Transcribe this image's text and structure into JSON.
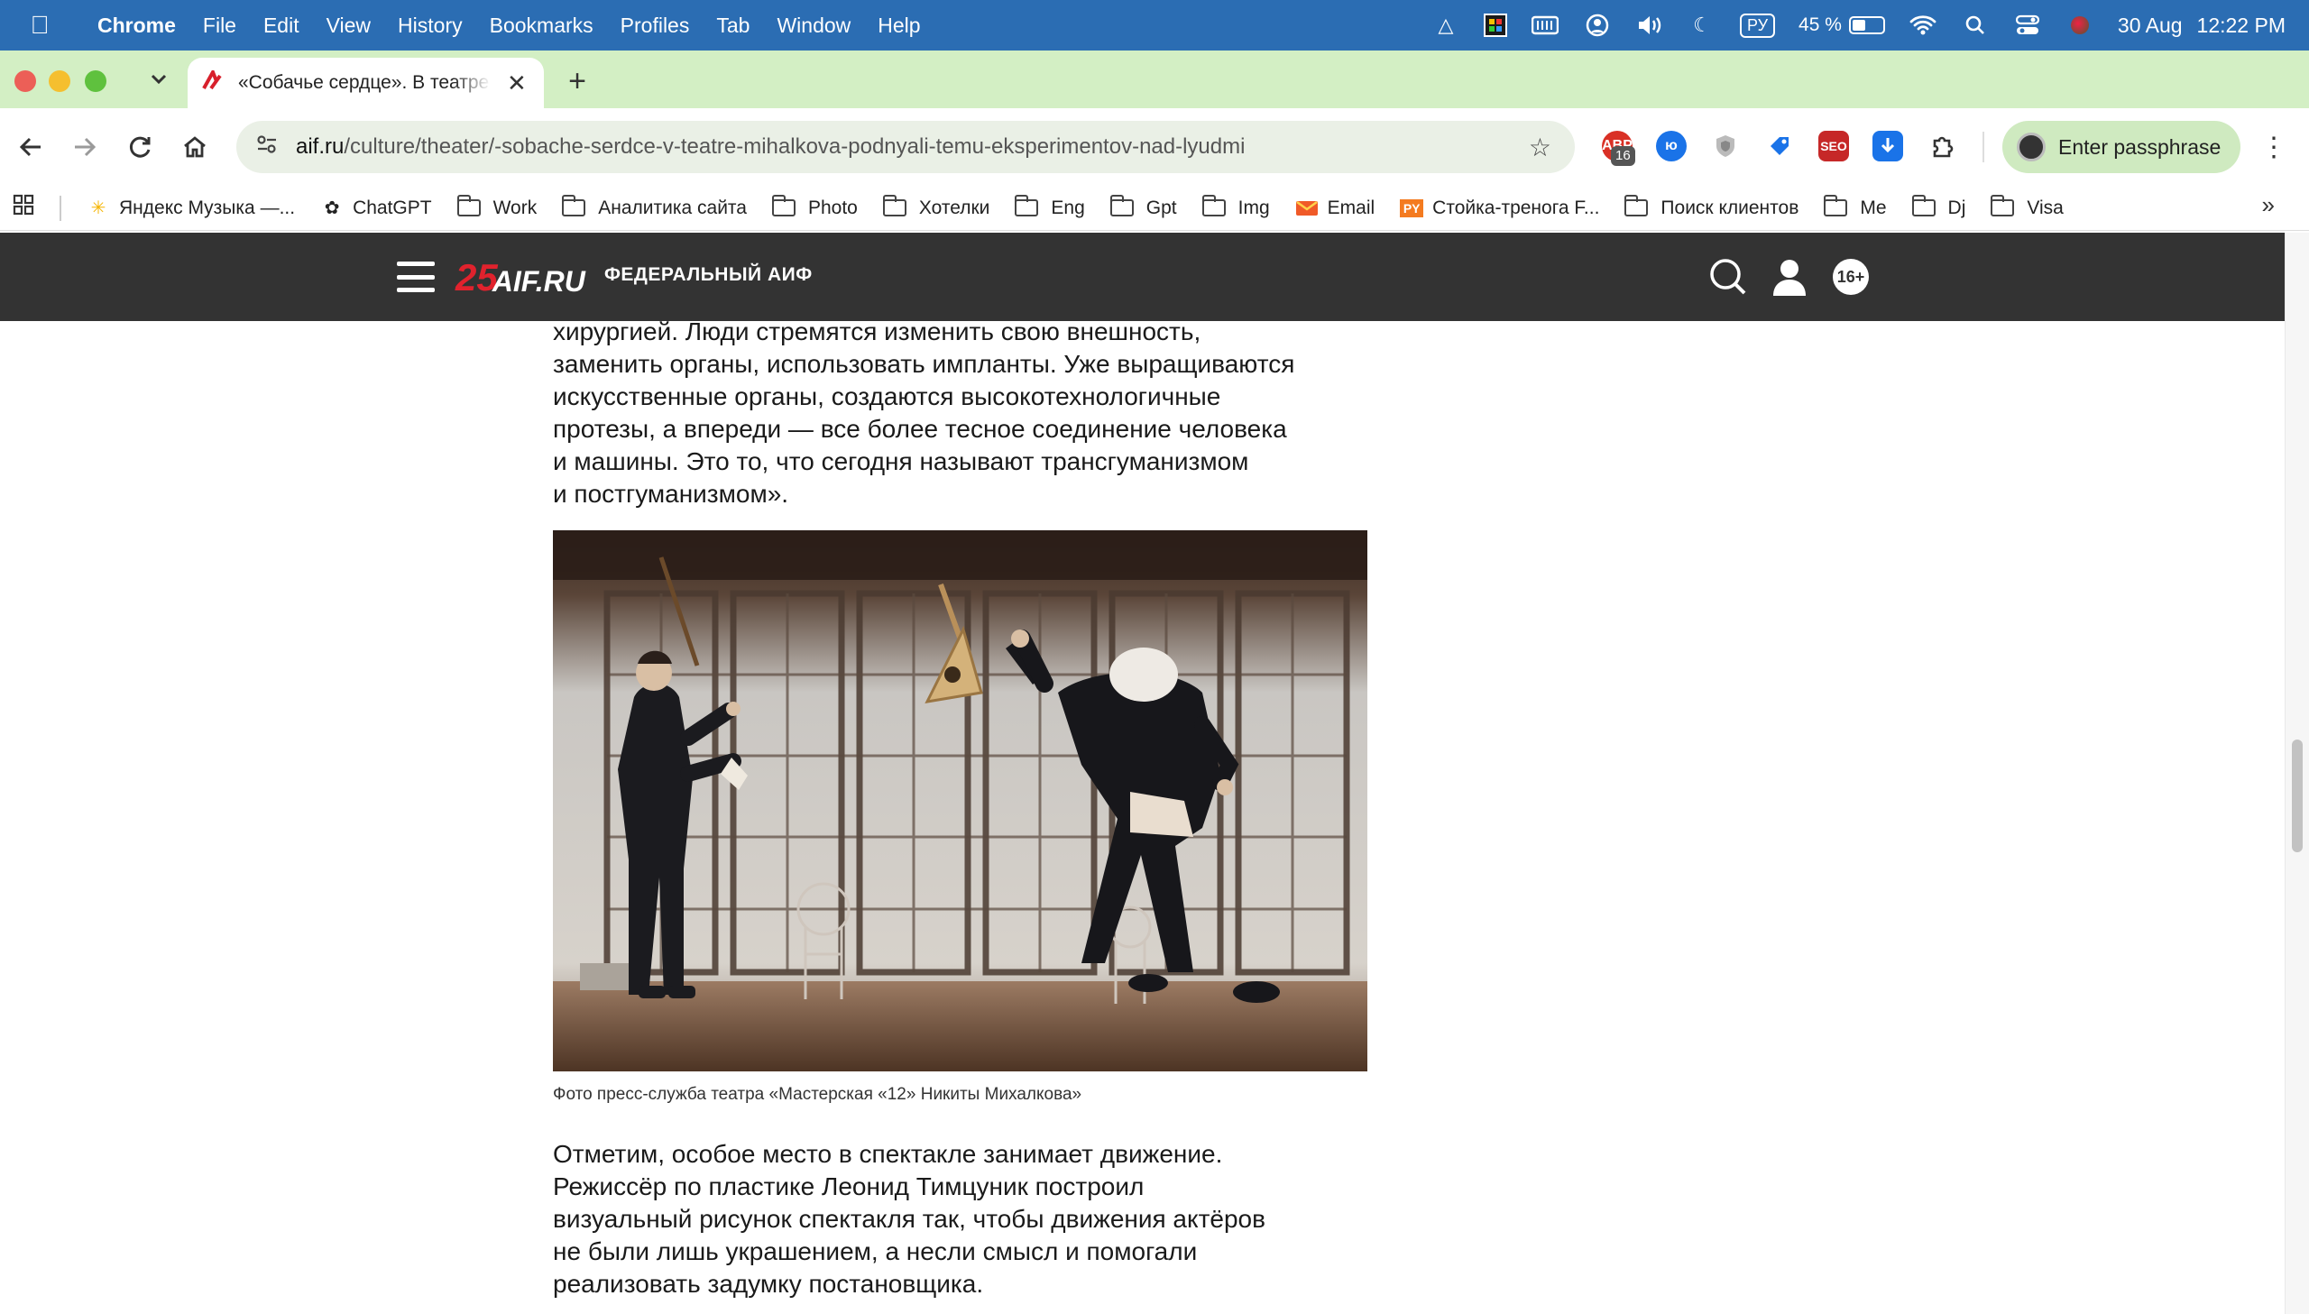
{
  "menubar": {
    "app": "Chrome",
    "items": [
      "File",
      "Edit",
      "View",
      "History",
      "Bookmarks",
      "Profiles",
      "Tab",
      "Window",
      "Help"
    ],
    "input_source": "РУ",
    "battery_text": "45 %",
    "battery_level": 0.45,
    "date": "30 Aug",
    "time": "12:22 PM"
  },
  "tabs": [
    {
      "title": "«Собачье сердце». В театре Михалкова подняли тему экспериментов над людьми",
      "favicon": "aif-logo-icon"
    }
  ],
  "toolbar": {
    "url_host": "aif.ru",
    "url_path": "/culture/theater/-sobache-serdce-v-teatre-mihalkova-podnyali-temu-eksperimentov-nad-lyudmi",
    "extension_badge": "16",
    "passphrase_button": "Enter passphrase"
  },
  "bookmarks": [
    {
      "label": "Яндекс Музыка —...",
      "icon": "yandex-music-icon"
    },
    {
      "label": "ChatGPT",
      "icon": "chatgpt-icon"
    },
    {
      "label": "Work",
      "icon": "folder-icon"
    },
    {
      "label": "Аналитика сайта",
      "icon": "folder-icon"
    },
    {
      "label": "Photo",
      "icon": "folder-icon"
    },
    {
      "label": "Хотелки",
      "icon": "folder-icon"
    },
    {
      "label": "Eng",
      "icon": "folder-icon"
    },
    {
      "label": "Gpt",
      "icon": "folder-icon"
    },
    {
      "label": "Img",
      "icon": "folder-icon"
    },
    {
      "label": "Email",
      "icon": "email-icon"
    },
    {
      "label": "Стойка-тренога F...",
      "icon": "ru-site-icon"
    },
    {
      "label": "Поиск клиентов",
      "icon": "folder-icon"
    },
    {
      "label": "Me",
      "icon": "folder-icon"
    },
    {
      "label": "Dj",
      "icon": "folder-icon"
    },
    {
      "label": "Visa",
      "icon": "folder-icon"
    }
  ],
  "site": {
    "logo_number": "25",
    "logo_name": "AIF.RU",
    "tagline": "ФЕДЕРАЛЬНЫЙ АИФ",
    "age_rating": "16+"
  },
  "article": {
    "paragraph_top_lines": [
      "хирургией. Люди стремятся изменить свою внешность,",
      "заменить органы, использовать импланты. Уже выращиваются",
      "искусственные органы, создаются высокотехнологичные",
      "протезы, а впереди — все более тесное соединение человека",
      "и машины. Это то, что сегодня называют трансгуманизмом",
      "и постгуманизмом»."
    ],
    "photo_caption": "Фото пресс-служба театра «Мастерская «12» Никиты Михалкова»",
    "paragraph_bottom_lines": [
      "Отметим, особое место в спектакле занимает движение.",
      "Режиссёр по пластике Леонид Тимцуник построил",
      "визуальный рисунок спектакля так, чтобы движения актёров",
      "не были лишь украшением, а несли смысл и помогали",
      "реализовать задумку постановщика."
    ]
  },
  "colors": {
    "menubar": "#2b6db3",
    "tabstrip": "#d3efc4",
    "site_header": "#333333",
    "logo_red": "#e1222d"
  }
}
